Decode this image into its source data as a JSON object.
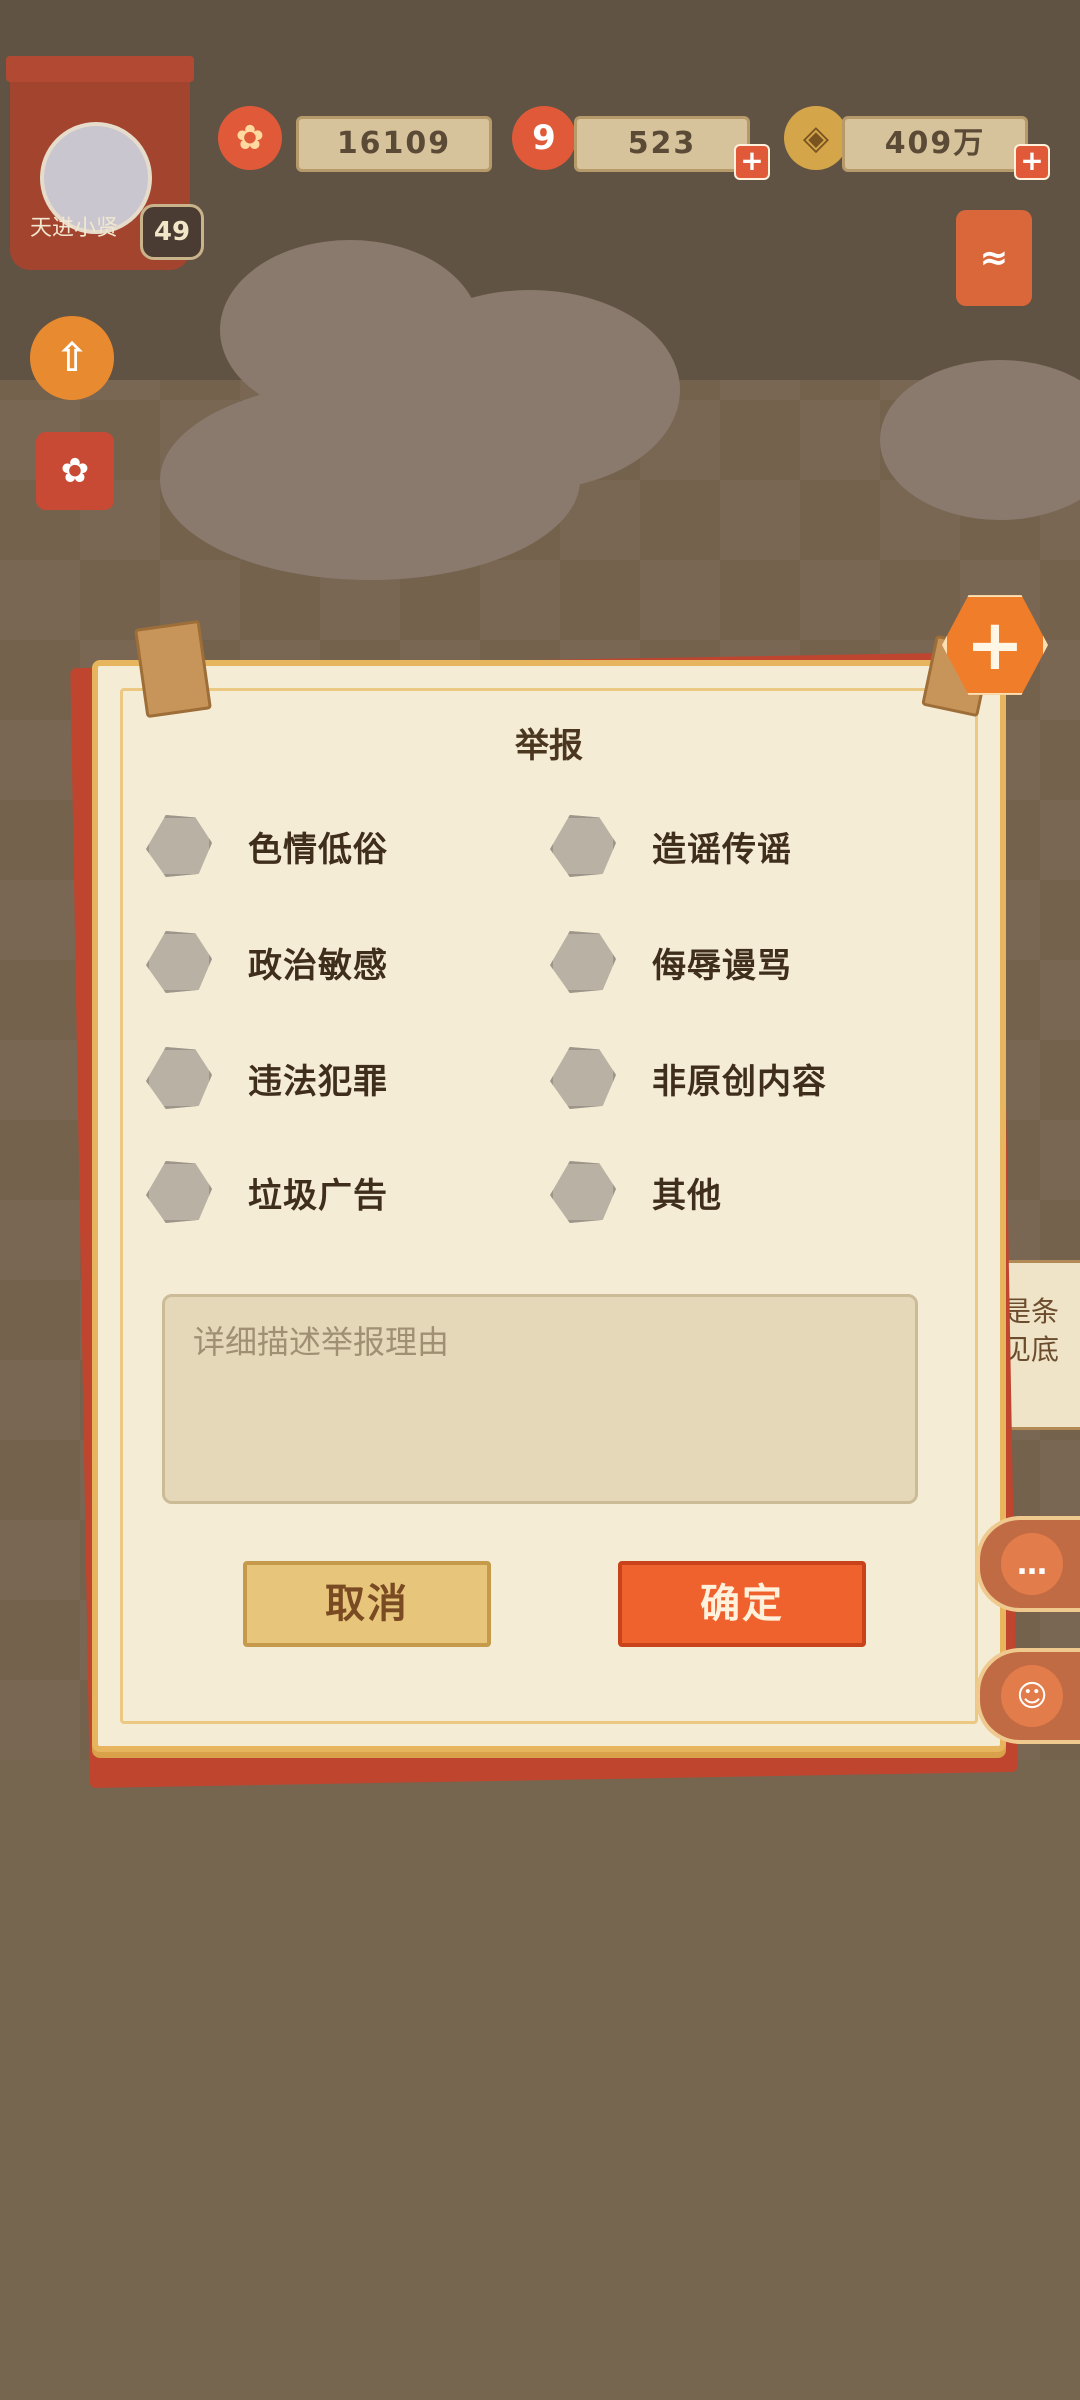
{
  "hud": {
    "player_name": "天进小贤",
    "level": "49",
    "petals": "16109",
    "gems": "523",
    "coins": "409万",
    "plus_symbol": "+"
  },
  "report_dialog": {
    "title": "举报",
    "options": [
      {
        "label": "色情低俗"
      },
      {
        "label": "造谣传谣"
      },
      {
        "label": "政治敏感"
      },
      {
        "label": "侮辱谩骂"
      },
      {
        "label": "违法犯罪"
      },
      {
        "label": "非原创内容"
      },
      {
        "label": "垃圾广告"
      },
      {
        "label": "其他"
      }
    ],
    "reason_placeholder": "详细描述举报理由",
    "cancel_label": "取消",
    "confirm_label": "确定",
    "close_symbol": "+"
  },
  "side_hint": {
    "line1": "是条",
    "line2": "见底"
  },
  "colors": {
    "accent_orange": "#f0622d",
    "modal_paper": "#f5ecd6",
    "modal_border": "#e7b55d"
  }
}
